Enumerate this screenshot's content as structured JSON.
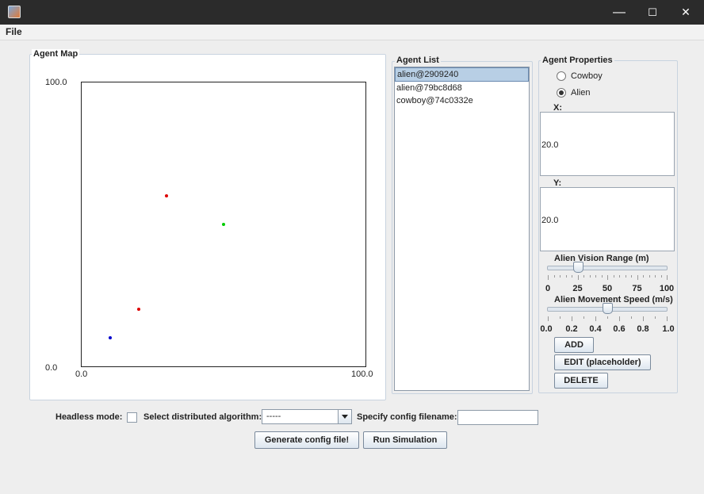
{
  "window": {
    "minimize": "—",
    "maximize": "☐",
    "close": "✕"
  },
  "menu": {
    "file": "File"
  },
  "agent_map": {
    "title": "Agent Map",
    "y_max_label": "100.0",
    "y_min_label": "0.0",
    "x_min_label": "0.0",
    "x_max_label": "100.0",
    "agents": [
      {
        "x": 30,
        "y": 60,
        "color": "#dd0000"
      },
      {
        "x": 50,
        "y": 50,
        "color": "#00cc00"
      },
      {
        "x": 20,
        "y": 20,
        "color": "#dd0000"
      },
      {
        "x": 10,
        "y": 10,
        "color": "#0000cc"
      }
    ]
  },
  "agent_list": {
    "title": "Agent List",
    "items": [
      "alien@2909240",
      "alien@79bc8d68",
      "cowboy@74c0332e"
    ],
    "selected_index": 0
  },
  "agent_properties": {
    "title": "Agent Properties",
    "radio_cowboy": "Cowboy",
    "radio_alien": "Alien",
    "selected_type": "Alien",
    "x_label": "X:",
    "x_value": "20.0",
    "y_label": "Y:",
    "y_value": "20.0",
    "vision_label": "Alien Vision Range (m)",
    "vision_ticks": [
      "0",
      "25",
      "50",
      "75",
      "100"
    ],
    "vision_value": 25,
    "speed_label": "Alien Movement Speed (m/s)",
    "speed_ticks": [
      "0.0",
      "0.2",
      "0.4",
      "0.6",
      "0.8",
      "1.0"
    ],
    "speed_value": 0.5,
    "add_button": "ADD",
    "edit_button": "EDIT (placeholder)",
    "delete_button": "DELETE"
  },
  "bottom": {
    "headless_label": "Headless mode:",
    "headless_checked": false,
    "algorithm_label": "Select distributed algorithm:",
    "algorithm_value": "-----",
    "config_label": "Specify config filename:",
    "config_value": "",
    "generate_button": "Generate config file!",
    "run_button": "Run Simulation"
  }
}
